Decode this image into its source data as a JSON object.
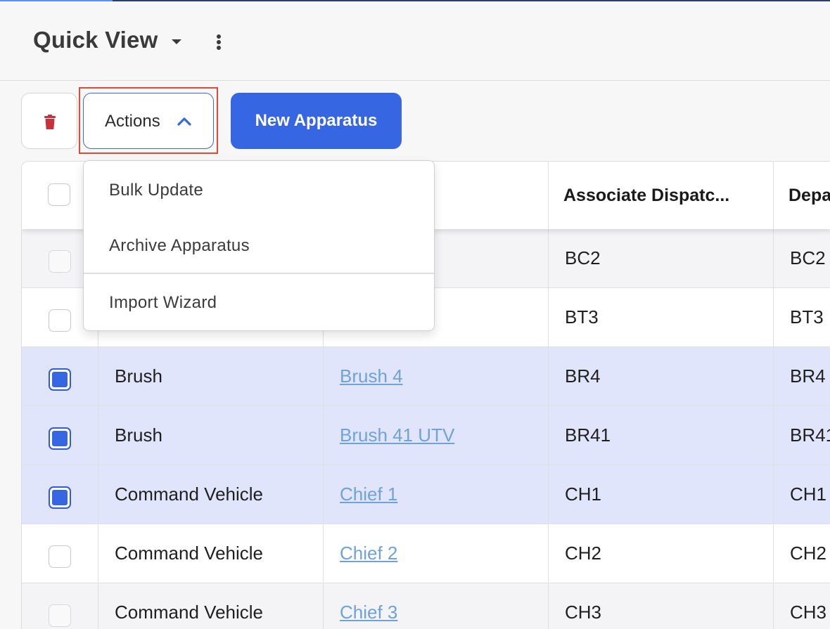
{
  "header": {
    "title": "Quick View"
  },
  "toolbar": {
    "actions_label": "Actions",
    "new_label": "New Apparatus"
  },
  "actions_menu": {
    "items": [
      "Bulk Update",
      "Archive Apparatus",
      "Import Wizard"
    ]
  },
  "table": {
    "columns": [
      "",
      "",
      "",
      "Associate Dispatc...",
      "Depa"
    ],
    "rows": [
      {
        "checked": false,
        "type": "",
        "name": "",
        "dispatch": "BC2",
        "dept": "BC2"
      },
      {
        "checked": false,
        "type": "",
        "name": "",
        "dispatch": "BT3",
        "dept": "BT3"
      },
      {
        "checked": true,
        "type": "Brush",
        "name": "Brush 4",
        "dispatch": "BR4",
        "dept": "BR4"
      },
      {
        "checked": true,
        "type": "Brush",
        "name": "Brush 41 UTV",
        "dispatch": "BR41",
        "dept": "BR41"
      },
      {
        "checked": true,
        "type": "Command Vehicle",
        "name": "Chief 1",
        "dispatch": "CH1",
        "dept": "CH1"
      },
      {
        "checked": false,
        "type": "Command Vehicle",
        "name": "Chief 2",
        "dispatch": "CH2",
        "dept": "CH2"
      },
      {
        "checked": false,
        "type": "Command Vehicle",
        "name": "Chief 3",
        "dispatch": "CH3",
        "dept": "CH3"
      }
    ]
  },
  "colors": {
    "primary": "#3766e3",
    "selected_row": "#e1e5fb",
    "link": "#6fa3d8",
    "danger": "#c9303a",
    "highlight_outline": "#e04a37"
  },
  "icons": [
    "trash-icon",
    "chevron-up-icon",
    "caret-down-icon",
    "kebab-menu-icon",
    "checkbox-icon"
  ]
}
